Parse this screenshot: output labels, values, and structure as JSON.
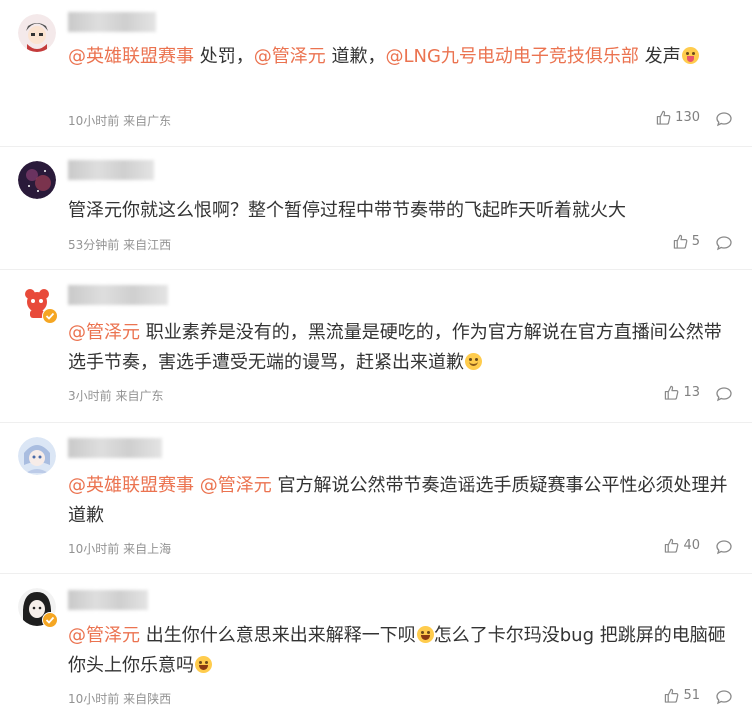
{
  "comments": [
    {
      "segments": [
        {
          "text": "@英雄联盟赛事",
          "type": "mention"
        },
        {
          "text": " 处罚，",
          "type": "text"
        },
        {
          "text": "@管泽元",
          "type": "mention"
        },
        {
          "text": " 道歉，",
          "type": "text"
        },
        {
          "text": "@LNG九号电动电子竞技俱乐部",
          "type": "mention"
        },
        {
          "text": " 发声",
          "type": "text"
        }
      ],
      "emoji": "tongue-emoji",
      "meta": "10小时前 来自广东",
      "likes": "130"
    },
    {
      "segments": [
        {
          "text": "管泽元你就这么恨啊？整个暂停过程中带节奏带的飞起昨天听着就火大",
          "type": "text"
        }
      ],
      "emoji": "",
      "meta": "53分钟前 来自江西",
      "likes": "5"
    },
    {
      "segments": [
        {
          "text": "@管泽元",
          "type": "mention"
        },
        {
          "text": " 职业素养是没有的，黑流量是硬吃的，作为官方解说在官方直播间公然带选手节奏，害选手遭受无端的谩骂，赶紧出来道歉",
          "type": "text"
        }
      ],
      "emoji": "smile-emoji",
      "meta": "3小时前 来自广东",
      "likes": "13"
    },
    {
      "segments": [
        {
          "text": "@英雄联盟赛事",
          "type": "mention"
        },
        {
          "text": " ",
          "type": "text"
        },
        {
          "text": "@管泽元",
          "type": "mention"
        },
        {
          "text": " 官方解说公然带节奏造谣选手质疑赛事公平性必须处理并道歉",
          "type": "text"
        }
      ],
      "emoji": "",
      "meta": "10小时前 来自上海",
      "likes": "40"
    },
    {
      "segments": [
        {
          "text": "@管泽元",
          "type": "mention"
        },
        {
          "text": " 出生你什么意思来出来解释一下呗",
          "type": "text"
        },
        {
          "text": "[laugh]",
          "type": "emoji"
        },
        {
          "text": "怎么了卡尔玛没bug 把跳屏的电脑砸你头上你乐意吗",
          "type": "text"
        }
      ],
      "emoji": "laugh-emoji",
      "meta": "10小时前 来自陕西",
      "likes": "51"
    }
  ],
  "colors": {
    "mention": "#eb7350",
    "text": "#333333",
    "meta": "#939393",
    "badge": "#f5a623"
  }
}
